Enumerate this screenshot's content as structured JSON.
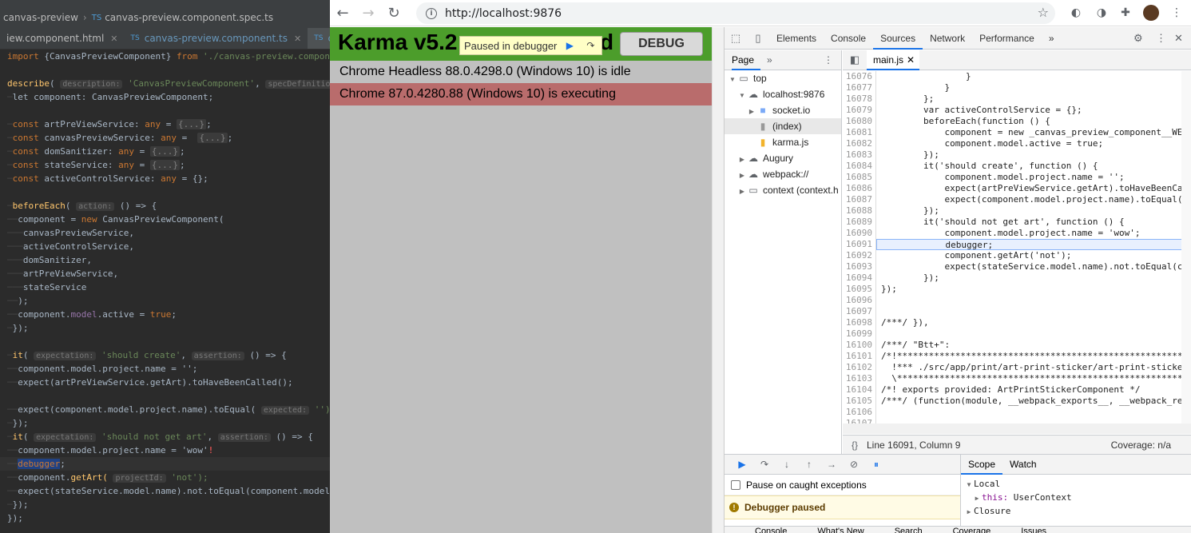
{
  "ide": {
    "breadcrumb": {
      "folder": "canvas-preview",
      "file": "canvas-preview.component.spec.ts"
    },
    "tabs": [
      {
        "label": "iew.component.html"
      },
      {
        "label": "canvas-preview.component.ts"
      },
      {
        "label": "canvas-pre"
      }
    ],
    "code": {
      "l1_import": "import",
      "l1_name": " {CanvasPreviewComponent} ",
      "l1_from": "from",
      "l1_path": " './canvas-preview.component';",
      "l3_fn": "describe",
      "l3_hint1": "description:",
      "l3_str": "'CanvasPreviewComponent'",
      "l3_hint2": "specDefinitions:",
      "l3_tail": "() => {",
      "l4": "let component: CanvasPreviewComponent;",
      "l6_name": "artPreViewService",
      "l7_name": "canvasPreviewService",
      "l8_name": "domSanitizer",
      "l9_name": "stateService",
      "l10_name": "activeControlService",
      "any": "any",
      "fold": "{...}",
      "empty_obj": "{};",
      "l12_fn": "beforeEach",
      "l12_hint": "action:",
      "l12_tail": "() => {",
      "l13_new": "new",
      "l13_cls": " CanvasPreviewComponent(",
      "l14": "canvasPreviewService,",
      "l15": "activeControlService,",
      "l16": "domSanitizer,",
      "l17": "artPreViewService,",
      "l18": "stateService",
      "l19": ");",
      "l20_a": "component.",
      "l20_b": "model",
      "l20_c": ".active = ",
      "l20_d": "true",
      "l21": "});",
      "it": "it",
      "hint_expectation": "expectation:",
      "should_create": "'should create'",
      "hint_assertion": "assertion:",
      "arrow": "() => {",
      "name_assign_empty": "component.model.project.name = '';",
      "expect_getart": "expect(artPreViewService.getArt).toHaveBeenCalled();",
      "expect_name_a": "expect(component.model.project.name).toEqual(",
      "hint_expected": "expected:",
      "expect_name_b": "'');",
      "should_not": "'should not get art'",
      "name_assign_wow": "component.model.project.name = 'wow'",
      "debugger_word": "debugger",
      "getart_a": "component.",
      "getart_b": "getArt(",
      "hint_projectid": "projectId:",
      "getart_c": "'not');",
      "expect_not": "expect(stateService.model.name).not.toEqual(component.model.pro",
      "close_it": "});",
      "close_describe": "});"
    }
  },
  "chrome": {
    "url": "http://localhost:9876",
    "karma": {
      "title": "Karma v5.2",
      "title_tail": "ed",
      "paused_chip": "Paused in debugger",
      "debug_button": "DEBUG",
      "browsers": [
        {
          "label": "Chrome Headless 88.0.4298.0 (Windows 10) is idle",
          "state": "idle"
        },
        {
          "label": "Chrome 87.0.4280.88 (Windows 10) is executing",
          "state": "executing"
        }
      ]
    }
  },
  "devtools": {
    "tabs": [
      "Elements",
      "Console",
      "Sources",
      "Network",
      "Performance"
    ],
    "active_tab": "Sources",
    "nav_tab": "Page",
    "tree": [
      "top",
      "localhost:9876",
      "socket.io",
      "(index)",
      "karma.js",
      "Augury",
      "webpack://",
      "context (context.h"
    ],
    "open_file": "main.js",
    "code_lines": [
      {
        "n": "16076",
        "t": "                }"
      },
      {
        "n": "16077",
        "t": "            }"
      },
      {
        "n": "16078",
        "t": "        };"
      },
      {
        "n": "16079",
        "t": "        var activeControlService = {};"
      },
      {
        "n": "16080",
        "t": "        beforeEach(function () {"
      },
      {
        "n": "16081",
        "t": "            component = new _canvas_preview_component__WEBPAC"
      },
      {
        "n": "16082",
        "t": "            component.model.active = true;"
      },
      {
        "n": "16083",
        "t": "        });"
      },
      {
        "n": "16084",
        "t": "        it('should create', function () {"
      },
      {
        "n": "16085",
        "t": "            component.model.project.name = '';"
      },
      {
        "n": "16086",
        "t": "            expect(artPreViewService.getArt).toHaveBeenCalled"
      },
      {
        "n": "16087",
        "t": "            expect(component.model.project.name).toEqual('');"
      },
      {
        "n": "16088",
        "t": "        });"
      },
      {
        "n": "16089",
        "t": "        it('should not get art', function () {"
      },
      {
        "n": "16090",
        "t": "            component.model.project.name = 'wow';"
      },
      {
        "n": "16091",
        "t": "            debugger;"
      },
      {
        "n": "16092",
        "t": "            component.getArt('not');"
      },
      {
        "n": "16093",
        "t": "            expect(stateService.model.name).not.toEqual(compo"
      },
      {
        "n": "16094",
        "t": "        });"
      },
      {
        "n": "16095",
        "t": "});"
      },
      {
        "n": "16096",
        "t": ""
      },
      {
        "n": "16097",
        "t": ""
      },
      {
        "n": "16098",
        "t": "/***/ }),"
      },
      {
        "n": "16099",
        "t": ""
      },
      {
        "n": "16100",
        "t": "/***/ \"Btt+\":"
      },
      {
        "n": "16101",
        "t": "/*!*******************************************************"
      },
      {
        "n": "16102",
        "t": "  !*** ./src/app/print/art-print-sticker/art-print-sticke"
      },
      {
        "n": "16103",
        "t": "  \\*******************************************************"
      },
      {
        "n": "16104",
        "t": "/*! exports provided: ArtPrintStickerComponent */"
      },
      {
        "n": "16105",
        "t": "/***/ (function(module, __webpack_exports__, __webpack_re"
      },
      {
        "n": "16106",
        "t": ""
      },
      {
        "n": "16107",
        "t": ""
      }
    ],
    "current_line": "16091",
    "status_position": "Line 16091, Column 9",
    "coverage": "Coverage: n/a",
    "pause_on_caught": "Pause on caught exceptions",
    "debugger_paused": "Debugger paused",
    "scope_tabs": [
      "Scope",
      "Watch"
    ],
    "scope": {
      "local": "Local",
      "this_key": "this:",
      "this_val": " UserContext",
      "closure": "Closure"
    },
    "drawer_tabs": [
      "Console",
      "What's New",
      "Search",
      "Coverage",
      "Issues"
    ]
  }
}
